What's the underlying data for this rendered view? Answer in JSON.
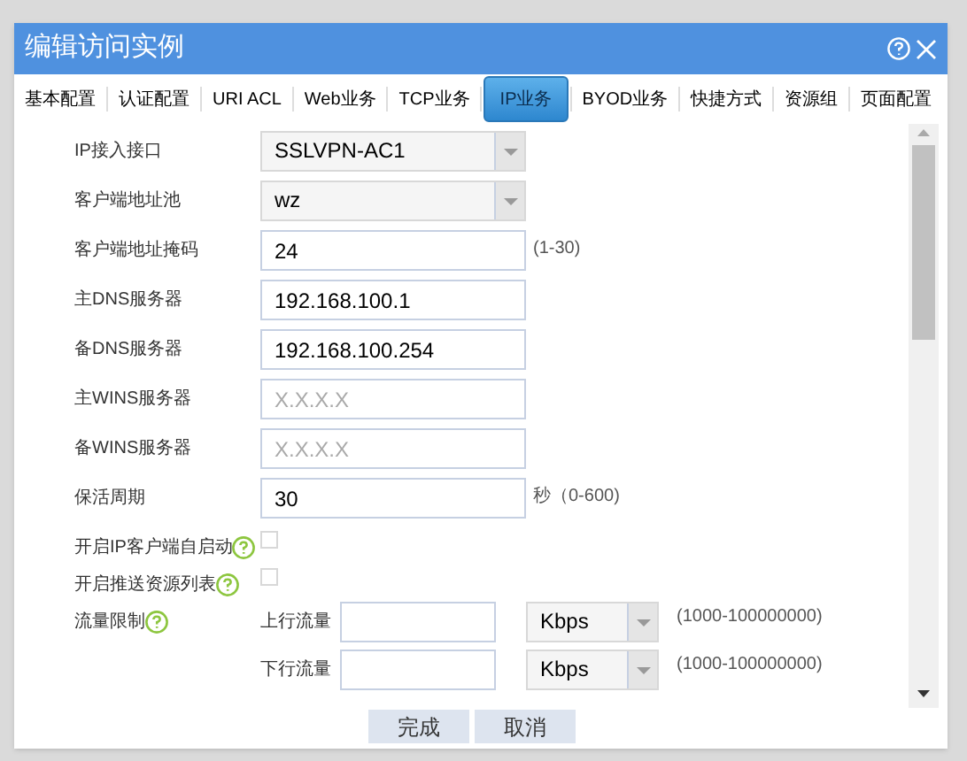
{
  "window": {
    "title": "编辑访问实例"
  },
  "tabs": [
    {
      "label": "基本配置",
      "selected": false
    },
    {
      "label": "认证配置",
      "selected": false
    },
    {
      "label": "URI ACL",
      "selected": false
    },
    {
      "label": "Web业务",
      "selected": false
    },
    {
      "label": "TCP业务",
      "selected": false
    },
    {
      "label": "IP业务",
      "selected": true
    },
    {
      "label": "BYOD业务",
      "selected": false
    },
    {
      "label": "快捷方式",
      "selected": false
    },
    {
      "label": "资源组",
      "selected": false
    },
    {
      "label": "页面配置",
      "selected": false
    }
  ],
  "fields": [
    {
      "kind": "select",
      "label": "IP接入接口",
      "value": "SSLVPN-AC1"
    },
    {
      "kind": "select",
      "label": "客户端地址池",
      "value": "wz"
    },
    {
      "kind": "text",
      "label": "客户端地址掩码",
      "value": "24",
      "hint": "(1-30)"
    },
    {
      "kind": "text",
      "label": "主DNS服务器",
      "value": "192.168.100.1"
    },
    {
      "kind": "text",
      "label": "备DNS服务器",
      "value": "192.168.100.254"
    },
    {
      "kind": "text",
      "label": "主WINS服务器",
      "placeholder": "X.X.X.X"
    },
    {
      "kind": "text",
      "label": "备WINS服务器",
      "placeholder": "X.X.X.X"
    },
    {
      "kind": "text",
      "label": "保活周期",
      "value": "30",
      "hint": "秒（0-600)"
    },
    {
      "kind": "checkbox",
      "label": "开启IP客户端自启动",
      "help": true,
      "checked": false
    },
    {
      "kind": "checkbox",
      "label": "开启推送资源列表",
      "help": true,
      "checked": false
    },
    {
      "kind": "traffic",
      "label": "流量限制",
      "help": true,
      "limits": [
        {
          "label": "上行流量",
          "unit": "Kbps",
          "hint": "(1000-100000000)"
        },
        {
          "label": "下行流量",
          "unit": "Kbps",
          "hint": "(1000-100000000)"
        }
      ]
    }
  ],
  "buttons": [
    "完成",
    "取消"
  ]
}
